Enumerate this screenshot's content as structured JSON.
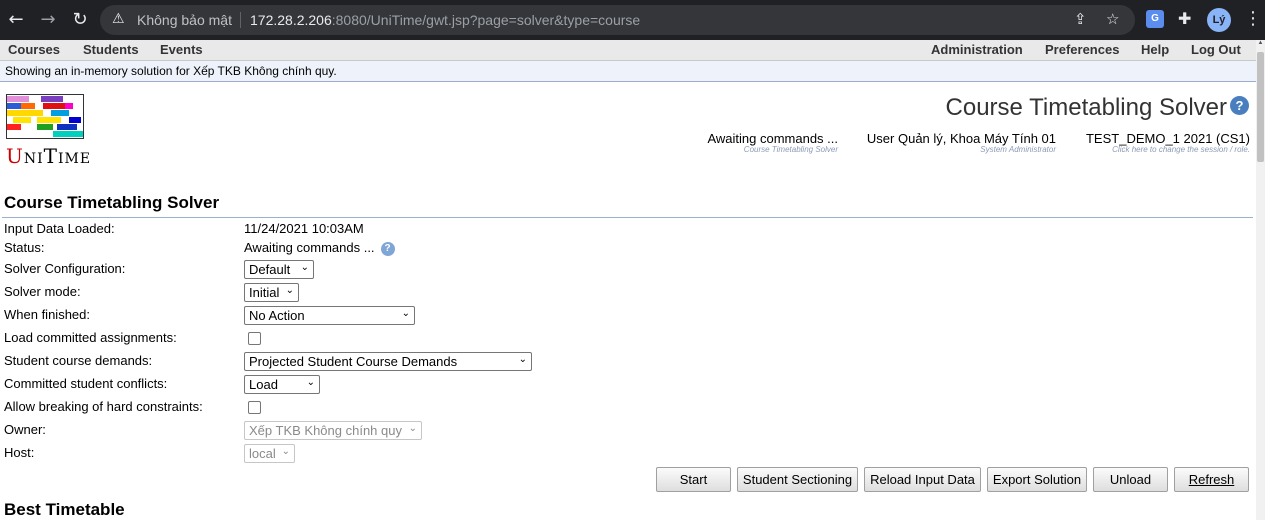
{
  "browser": {
    "security_label": "Không bảo mật",
    "url_host": "172.28.2.206",
    "url_rest": ":8080/UniTime/gwt.jsp?page=solver&type=course",
    "profile_initials": "Lý"
  },
  "menu": {
    "left": [
      "Courses",
      "Students",
      "Events"
    ],
    "right": [
      "Administration",
      "Preferences",
      "Help",
      "Log Out"
    ]
  },
  "info_message": "Showing an in-memory solution for Xếp TKB Không chính quy.",
  "logo": {
    "first": "U",
    "rest": "niTime"
  },
  "header": {
    "title": "Course Timetabling Solver",
    "status": {
      "main": "Awaiting commands ...",
      "sub": "Course Timetabling Solver"
    },
    "user": {
      "main": "User Quản lý, Khoa Máy Tính 01",
      "sub": "System Administrator"
    },
    "session": {
      "main": "TEST_DEMO_1 2021 (CS1)",
      "sub": "Click here to change the session / role."
    }
  },
  "section_title": "Course Timetabling Solver",
  "form": {
    "input_data_loaded": {
      "label": "Input Data Loaded:",
      "value": "11/24/2021 10:03AM"
    },
    "status": {
      "label": "Status:",
      "value": "Awaiting commands ..."
    },
    "solver_configuration": {
      "label": "Solver Configuration:",
      "value": "Default"
    },
    "solver_mode": {
      "label": "Solver mode:",
      "value": "Initial"
    },
    "when_finished": {
      "label": "When finished:",
      "value": "No Action"
    },
    "load_committed": {
      "label": "Load committed assignments:",
      "checked": false
    },
    "student_course_demands": {
      "label": "Student course demands:",
      "value": "Projected Student Course Demands"
    },
    "committed_student_conflicts": {
      "label": "Committed student conflicts:",
      "value": "Load"
    },
    "allow_breaking": {
      "label": "Allow breaking of hard constraints:",
      "checked": false
    },
    "owner": {
      "label": "Owner:",
      "value": "Xếp TKB Không chính quy"
    },
    "host": {
      "label": "Host:",
      "value": "local"
    }
  },
  "buttons": {
    "start": "Start",
    "student_sectioning": "Student Sectioning",
    "reload_input_data": "Reload Input Data",
    "export_solution": "Export Solution",
    "unload": "Unload",
    "refresh": "Refresh"
  },
  "best_timetable_title": "Best Timetable"
}
